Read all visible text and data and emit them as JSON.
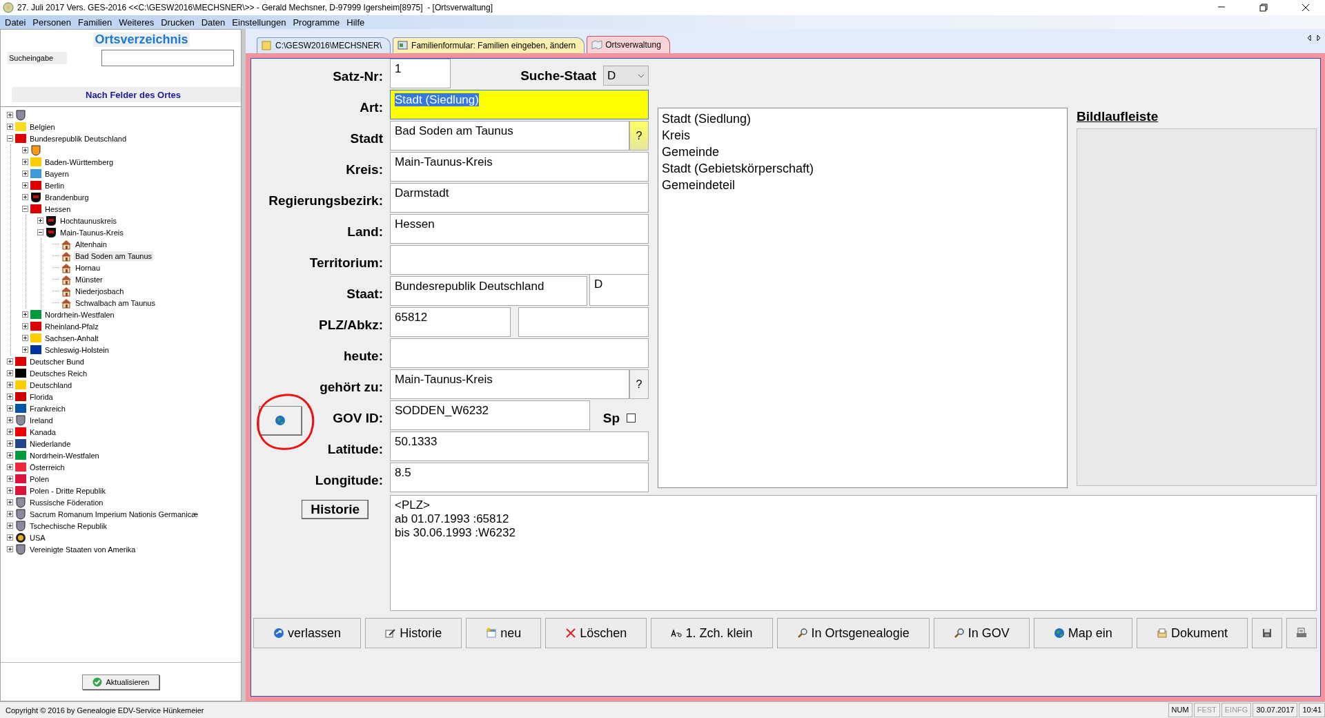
{
  "window": {
    "title": "27. Juli 2017 Vers. GES-2016 <<C:\\GESW2016\\MECHSNER\\>> - Gerald Mechsner, D-97999 Igersheim[8975]  - [Ortsverwaltung]"
  },
  "menu": [
    "Datei",
    "Personen",
    "Familien",
    "Weiteres",
    "Drucken",
    "Daten",
    "Einstellungen",
    "Programme",
    "Hilfe"
  ],
  "sidebar": {
    "title": "Ortsverzeichnis",
    "search": {
      "label": "Sucheingabe"
    },
    "section": "Nach Felder des Ortes",
    "tree": [
      {
        "kind": "shield",
        "expanded": false,
        "selected": false
      },
      {
        "kind": "flag",
        "color": "#fdda24",
        "label": "Belgien",
        "expanded": false,
        "selected": false
      },
      {
        "kind": "flag",
        "color": "#dd0000",
        "label": "Bundesrepublik Deutschland",
        "expanded": true,
        "selected": false,
        "children": [
          {
            "kind": "crest",
            "expanded": false,
            "selected": false
          },
          {
            "kind": "flag",
            "color": "#ffcc00",
            "label": "Baden-Württemberg",
            "expanded": false,
            "selected": false
          },
          {
            "kind": "flag",
            "color": "#3c9bd7",
            "label": "Bayern",
            "expanded": false,
            "selected": false
          },
          {
            "kind": "flag",
            "color": "#dd0000",
            "label": "Berlin",
            "expanded": false,
            "selected": false
          },
          {
            "kind": "arms",
            "label": "Brandenburg",
            "expanded": false,
            "selected": false
          },
          {
            "kind": "flag",
            "color": "#dd0000",
            "label": "Hessen",
            "expanded": true,
            "selected": false,
            "children": [
              {
                "kind": "arms",
                "label": "Hochtaunuskreis",
                "expanded": false,
                "selected": false
              },
              {
                "kind": "arms",
                "label": "Main-Taunus-Kreis",
                "expanded": true,
                "selected": false,
                "children": [
                  {
                    "kind": "house",
                    "label": "Altenhain",
                    "selected": false
                  },
                  {
                    "kind": "house",
                    "label": "Bad Soden am Taunus",
                    "selected": true
                  },
                  {
                    "kind": "house",
                    "label": "Hornau",
                    "selected": false
                  },
                  {
                    "kind": "house",
                    "label": "Münster",
                    "selected": false
                  },
                  {
                    "kind": "house",
                    "label": "Niederjosbach",
                    "selected": false
                  },
                  {
                    "kind": "house",
                    "label": "Schwalbach am Taunus",
                    "selected": false
                  }
                ]
              }
            ]
          },
          {
            "kind": "flag",
            "color": "#009a3d",
            "label": "Nordrhein-Westfalen",
            "expanded": false,
            "selected": false
          },
          {
            "kind": "flag",
            "color": "#dd0000",
            "label": "Rheinland-Pfalz",
            "expanded": false,
            "selected": false
          },
          {
            "kind": "flag",
            "color": "#ffcc00",
            "label": "Sachsen-Anhalt",
            "expanded": false,
            "selected": false
          },
          {
            "kind": "flag",
            "color": "#0033a0",
            "label": "Schleswig-Holstein",
            "expanded": false,
            "selected": false
          }
        ]
      },
      {
        "kind": "flag",
        "color": "#dd0000",
        "label": "Deutscher Bund",
        "expanded": false,
        "selected": false
      },
      {
        "kind": "flag",
        "color": "#000000",
        "label": "Deutsches Reich",
        "expanded": false,
        "selected": false
      },
      {
        "kind": "flag",
        "color": "#ffcc00",
        "label": "Deutschland",
        "expanded": false,
        "selected": false
      },
      {
        "kind": "flag",
        "color": "#cc0000",
        "label": "Florida",
        "expanded": false,
        "selected": false
      },
      {
        "kind": "flag",
        "color": "#0055a4",
        "label": "Frankreich",
        "expanded": false,
        "selected": false
      },
      {
        "kind": "shield",
        "label": "Ireland",
        "expanded": false,
        "selected": false
      },
      {
        "kind": "flag",
        "color": "#ee0000",
        "label": "Kanada",
        "expanded": false,
        "selected": false
      },
      {
        "kind": "flag",
        "color": "#21468b",
        "label": "Niederlande",
        "expanded": false,
        "selected": false
      },
      {
        "kind": "flag",
        "color": "#009a3d",
        "label": "Nordrhein-Westfalen",
        "expanded": false,
        "selected": false
      },
      {
        "kind": "flag",
        "color": "#ed2939",
        "label": "Österreich",
        "expanded": false,
        "selected": false
      },
      {
        "kind": "flag",
        "color": "#dc143c",
        "label": "Polen",
        "expanded": false,
        "selected": false
      },
      {
        "kind": "flag",
        "color": "#dc143c",
        "label": "Polen - Dritte Republik",
        "expanded": false,
        "selected": false
      },
      {
        "kind": "shield",
        "label": "Russische Föderation",
        "expanded": false,
        "selected": false
      },
      {
        "kind": "shield",
        "label": "Sacrum Romanum Imperium Nationis Germanicæ",
        "expanded": false,
        "selected": false
      },
      {
        "kind": "shield",
        "label": "Tschechische Republik",
        "expanded": false,
        "selected": false
      },
      {
        "kind": "seal",
        "label": "USA",
        "expanded": false,
        "selected": false
      },
      {
        "kind": "shield",
        "label": "Vereinigte Staaten von Amerika",
        "expanded": false,
        "selected": false
      }
    ],
    "refresh_button": "Aktualisieren"
  },
  "tabs": [
    {
      "label": "C:\\GESW2016\\MECHSNER\\",
      "kind": "folder",
      "color": "#dde8f7",
      "selected": false
    },
    {
      "label": "Familienformular: Familien eingeben, ändern",
      "kind": "form",
      "color": "#fdf0b0",
      "selected": false
    },
    {
      "label": "Ortsverwaltung",
      "kind": "places",
      "color": "#f8d3d7",
      "selected": true
    }
  ],
  "form": {
    "record": {
      "label": "Satz-Nr:",
      "value": "1"
    },
    "country_search": {
      "label": "Suche-Staat",
      "value": "D"
    },
    "fields": [
      {
        "kind": "marked",
        "label": "Art:",
        "value": "Stadt (Siedlung)",
        "text_selected": true
      },
      {
        "kind": "lookup",
        "label": "Stadt",
        "value": "Bad Soden am Taunus",
        "button": "?",
        "button_active": true
      },
      {
        "kind": "text",
        "label": "Kreis:",
        "value": "Main-Taunus-Kreis"
      },
      {
        "kind": "text",
        "label": "Regierungsbezirk:",
        "value": "Darmstadt"
      },
      {
        "kind": "text",
        "label": "Land:",
        "value": "Hessen"
      },
      {
        "kind": "text",
        "label": "Territorium:"
      },
      {
        "kind": "pair",
        "label": "Staat:",
        "value": "Bundesrepublik Deutschland",
        "value_2": "D"
      },
      {
        "kind": "split",
        "label": "PLZ/Abkz:",
        "value": "65812"
      },
      {
        "kind": "text",
        "label": "heute:"
      },
      {
        "kind": "lookup",
        "label": "gehört zu:",
        "value": "Main-Taunus-Kreis",
        "button": "?",
        "button_active": false
      },
      {
        "kind": "gov",
        "label": "GOV ID:",
        "value": "SODDEN_W6232",
        "checkbox_label": "Sp",
        "checked": false,
        "circled": true
      },
      {
        "kind": "text",
        "label": "Latitude:",
        "value": "50.1333"
      },
      {
        "kind": "text",
        "label": "Longitude:",
        "value": "8.5"
      }
    ],
    "history": {
      "button": "Historie",
      "lines": [
        "<PLZ>",
        "ab 01.07.1993 :65812",
        "bis 30.06.1993 :W6232"
      ]
    }
  },
  "type_list": [
    {
      "label": "Stadt (Siedlung)",
      "selected": false
    },
    {
      "label": "Kreis",
      "selected": false
    },
    {
      "label": "Gemeinde",
      "selected": false
    },
    {
      "label": "Stadt (Gebietskörperschaft)",
      "selected": false
    },
    {
      "label": "Gemeindeteil",
      "selected": false
    }
  ],
  "image_strip": {
    "title": "Bildlaufleiste"
  },
  "buttons": [
    {
      "kind": "exit",
      "label": "verlassen"
    },
    {
      "kind": "history",
      "label": "Historie"
    },
    {
      "kind": "new",
      "label": "neu"
    },
    {
      "kind": "delete",
      "label": "Löschen"
    },
    {
      "kind": "lowercase",
      "label": "1. Zch. klein"
    },
    {
      "kind": "search",
      "label": "In Ortsgenealogie"
    },
    {
      "kind": "search",
      "label": "In GOV"
    },
    {
      "kind": "map",
      "label": "Map ein"
    },
    {
      "kind": "document",
      "label": "Dokument"
    },
    {
      "kind": "save"
    },
    {
      "kind": "print"
    }
  ],
  "status_bar": {
    "text": "Copyright © 2016 by Genealogie EDV-Service Hünkemeier",
    "panels": [
      {
        "label": "NUM",
        "active": true
      },
      {
        "label": "FEST",
        "active": false
      },
      {
        "label": "EINFG",
        "active": false
      },
      {
        "label": "30.07.2017",
        "active": true
      },
      {
        "label": "10:41",
        "active": true
      }
    ]
  }
}
